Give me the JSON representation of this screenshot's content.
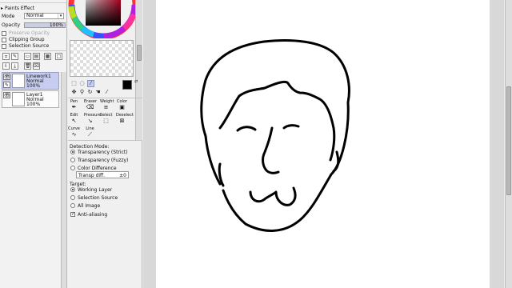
{
  "layer_panel": {
    "header": "Paints Effect",
    "mode_label": "Mode",
    "mode_value": "Normal",
    "opacity_label": "Opacity",
    "opacity_value": "100%",
    "opacity_fraction": 1.0,
    "options": [
      {
        "label": "Preserve Opacity",
        "checked": false,
        "disabled": true
      },
      {
        "label": "Clipping Group",
        "checked": false,
        "disabled": false
      },
      {
        "label": "Selection Source",
        "checked": false,
        "disabled": false
      }
    ],
    "layers": [
      {
        "name": "Linework1",
        "mode": "Normal",
        "opacity": "100%",
        "active": true
      },
      {
        "name": "Layer1",
        "mode": "Normal",
        "opacity": "100%",
        "active": false
      }
    ]
  },
  "tool_panel": {
    "tools": [
      {
        "name": "Pen",
        "icon": "pen-icon"
      },
      {
        "name": "Eraser",
        "icon": "eraser-icon"
      },
      {
        "name": "Weight",
        "icon": "weight-icon"
      },
      {
        "name": "Color",
        "icon": "color-icon"
      },
      {
        "name": "Edit",
        "icon": "edit-icon"
      },
      {
        "name": "Pressure",
        "icon": "pressure-icon"
      },
      {
        "name": "Select",
        "icon": "select-icon"
      },
      {
        "name": "Deselect",
        "icon": "deselect-icon"
      },
      {
        "name": "Curve",
        "icon": "curve-icon"
      },
      {
        "name": "Line",
        "icon": "line-icon"
      }
    ],
    "detection_mode_label": "Detection Mode:",
    "detection_modes": [
      {
        "label": "Transparency (Strict)",
        "selected": true
      },
      {
        "label": "Transparency (Fuzzy)",
        "selected": false
      },
      {
        "label": "Color Difference",
        "selected": false
      }
    ],
    "transp_label": "Transp diff.",
    "transp_value": "±0",
    "target_label": "Target:",
    "targets": [
      {
        "label": "Working Layer",
        "selected": true
      },
      {
        "label": "Selection Source",
        "selected": false
      },
      {
        "label": "All Image",
        "selected": false
      }
    ],
    "antialias_label": "Anti-aliasing",
    "antialias_checked": true
  },
  "colors": {
    "foreground": "#000000",
    "background": "#ffffff",
    "active_layer": "#c7cdf0",
    "canvas": "#ffffff"
  }
}
